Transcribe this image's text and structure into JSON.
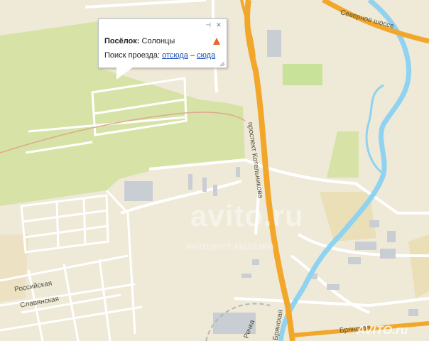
{
  "popup": {
    "place_type": "Посёлок:",
    "place_name": "Солонцы",
    "route_label": "Поиск проезда:",
    "from_link": "отсюда",
    "separator": "–",
    "to_link": "сюда"
  },
  "streets": {
    "severnoe": "Северное шоссе",
    "prospekt": "проспект Котельникова",
    "rossiyskaya": "Российская",
    "slavyanskaya": "Славянская",
    "bryanskaya_v": "Брянская",
    "bryanskaya_h": "Брянская",
    "richka": "Речка"
  },
  "watermarks": {
    "main": "avito.ru",
    "sub": "интернет-магазин",
    "corner": "AVITO.ru"
  },
  "colors": {
    "background": "#efe9d8",
    "forest": "#d7e3a6",
    "highway": "#f2a72a",
    "river": "#8fd3f0",
    "road": "#ffffff",
    "building": "#c9ced4",
    "sand": "#e9dcae"
  }
}
